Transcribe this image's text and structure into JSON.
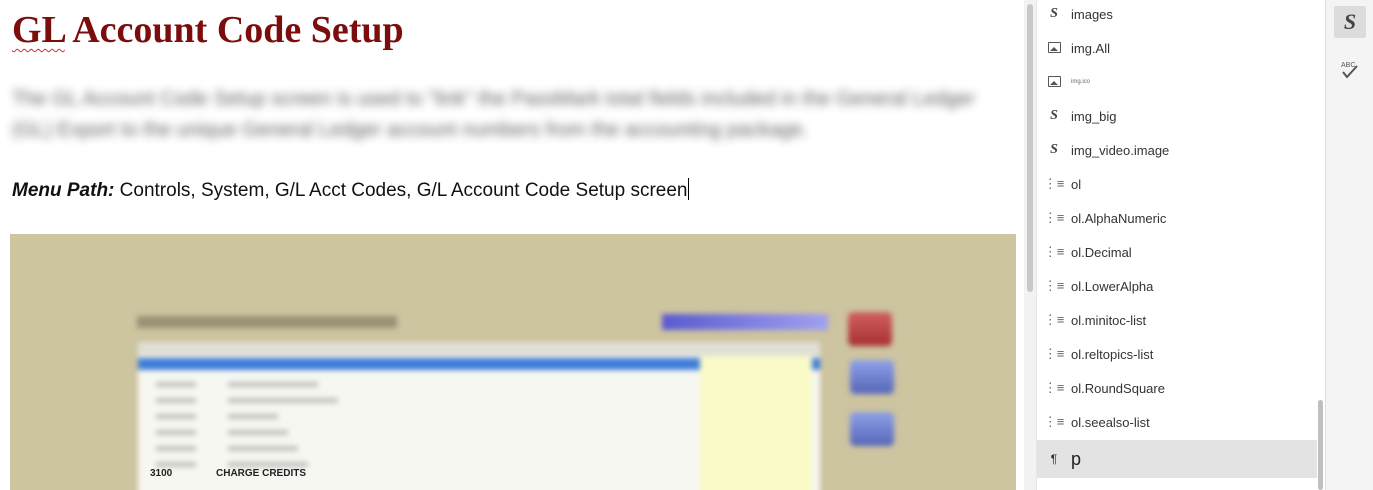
{
  "document": {
    "heading_gl": "GL",
    "heading_rest": " Account Code Setup",
    "intro_text": "The GL Account Code Setup screen is used to \"link\" the PassMark total fields included in the General Ledger (GL) Export to the unique General Ledger account numbers from the accounting package.",
    "menu_path_label": "Menu Path:",
    "menu_path_value": " Controls, System, G/L Acct Codes, G/L Account Code Setup screen",
    "screenshot": {
      "visible_row_code": "3100",
      "visible_row_desc": "CHARGE CREDITS"
    }
  },
  "styles_panel": {
    "items": [
      {
        "icon": "s",
        "label": "images"
      },
      {
        "icon": "img",
        "label": "img.All"
      },
      {
        "icon": "img",
        "label": "img.ico"
      },
      {
        "icon": "s",
        "label": "img_big"
      },
      {
        "icon": "s",
        "label": "img_video.image"
      },
      {
        "icon": "list",
        "label": "ol"
      },
      {
        "icon": "list",
        "label": "ol.AlphaNumeric"
      },
      {
        "icon": "list",
        "label": "ol.Decimal"
      },
      {
        "icon": "list",
        "label": "ol.LowerAlpha"
      },
      {
        "icon": "list",
        "label": "ol.minitoc-list"
      },
      {
        "icon": "list",
        "label": "ol.reltopics-list"
      },
      {
        "icon": "list",
        "label": "ol.RoundSquare"
      },
      {
        "icon": "list",
        "label": "ol.seealso-list"
      }
    ],
    "selected": {
      "icon": "¶",
      "label": "p"
    }
  },
  "toolbar": {
    "styles_glyph": "S",
    "spell_glyph": "ABC"
  },
  "icons": {
    "style_glyph": "S",
    "list_glyph": "⁝☰",
    "paragraph_glyph": "¶"
  }
}
